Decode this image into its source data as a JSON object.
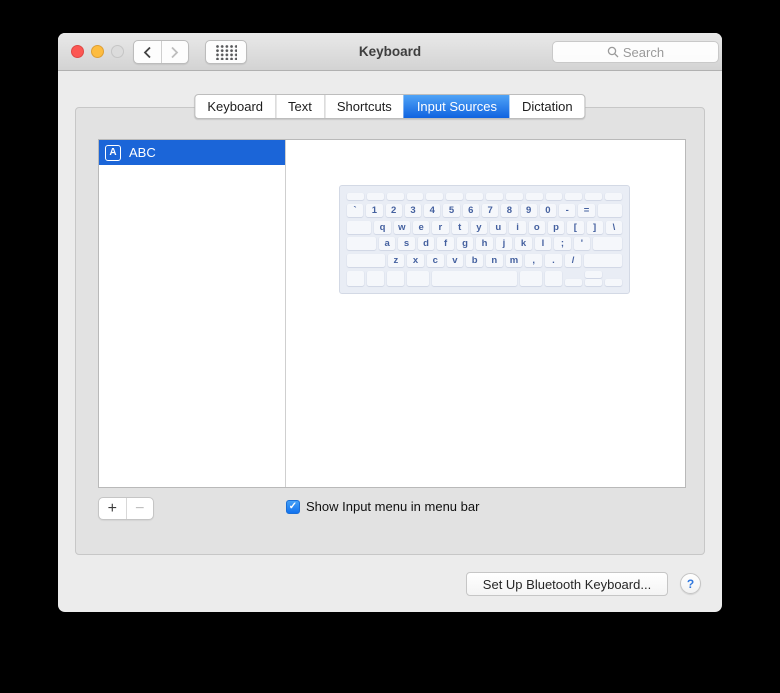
{
  "window": {
    "title": "Keyboard",
    "search_placeholder": "Search"
  },
  "tabs": [
    {
      "label": "Keyboard",
      "selected": false
    },
    {
      "label": "Text",
      "selected": false
    },
    {
      "label": "Shortcuts",
      "selected": false
    },
    {
      "label": "Input Sources",
      "selected": true
    },
    {
      "label": "Dictation",
      "selected": false
    }
  ],
  "source_list": {
    "items": [
      {
        "icon_letter": "A",
        "label": "ABC",
        "selected": true
      }
    ]
  },
  "keyboard_preview": {
    "rows": [
      {
        "type": "fn",
        "keys": [
          {},
          {},
          {},
          {},
          {},
          {},
          {},
          {},
          {},
          {},
          {},
          {},
          {},
          {}
        ]
      },
      {
        "keys": [
          {
            "t": "`"
          },
          {
            "t": "1"
          },
          {
            "t": "2"
          },
          {
            "t": "3"
          },
          {
            "t": "4"
          },
          {
            "t": "5"
          },
          {
            "t": "6"
          },
          {
            "t": "7"
          },
          {
            "t": "8"
          },
          {
            "t": "9"
          },
          {
            "t": "0"
          },
          {
            "t": "-"
          },
          {
            "t": "="
          },
          {
            "w": 1.5
          }
        ]
      },
      {
        "keys": [
          {
            "w": 1.5
          },
          {
            "t": "q"
          },
          {
            "t": "w"
          },
          {
            "t": "e"
          },
          {
            "t": "r"
          },
          {
            "t": "t"
          },
          {
            "t": "y"
          },
          {
            "t": "u"
          },
          {
            "t": "i"
          },
          {
            "t": "o"
          },
          {
            "t": "p"
          },
          {
            "t": "["
          },
          {
            "t": "]"
          },
          {
            "t": "\\"
          }
        ]
      },
      {
        "keys": [
          {
            "w": 1.75
          },
          {
            "t": "a"
          },
          {
            "t": "s"
          },
          {
            "t": "d"
          },
          {
            "t": "f"
          },
          {
            "t": "g"
          },
          {
            "t": "h"
          },
          {
            "t": "j"
          },
          {
            "t": "k"
          },
          {
            "t": "l"
          },
          {
            "t": ";"
          },
          {
            "t": "'"
          },
          {
            "w": 1.75
          }
        ]
      },
      {
        "keys": [
          {
            "w": 2.25
          },
          {
            "t": "z"
          },
          {
            "t": "x"
          },
          {
            "t": "c"
          },
          {
            "t": "v"
          },
          {
            "t": "b"
          },
          {
            "t": "n"
          },
          {
            "t": "m"
          },
          {
            "t": ","
          },
          {
            "t": "."
          },
          {
            "t": "/"
          },
          {
            "w": 2.25
          }
        ]
      },
      {
        "type": "bottom",
        "keys": [
          {
            "w": 1
          },
          {
            "w": 1
          },
          {
            "w": 1
          },
          {
            "w": 1.25
          },
          {
            "w": 5
          },
          {
            "w": 1.25
          },
          {
            "w": 1
          },
          {
            "arrow": "left"
          },
          {
            "arrow": "updown"
          },
          {
            "arrow": "right"
          }
        ]
      }
    ]
  },
  "footer": {
    "add_label": "+",
    "remove_label": "−",
    "checkbox_label": "Show Input menu in menu bar",
    "checkbox_checked": true,
    "checkmark": "✓"
  },
  "bottom_bar": {
    "bluetooth_button": "Set Up Bluetooth Keyboard...",
    "help_label": "?"
  },
  "colors": {
    "selection_blue": "#1b65d8",
    "tab_gradient_top": "#4fa3f6",
    "tab_gradient_bottom": "#1063e0",
    "checkbox_blue": "#1272ef",
    "key_text_blue": "#44609f",
    "window_bg": "#ececec",
    "groupbox_bg": "#e2e2e2",
    "keyboard_preview_bg": "#e9edf5"
  }
}
